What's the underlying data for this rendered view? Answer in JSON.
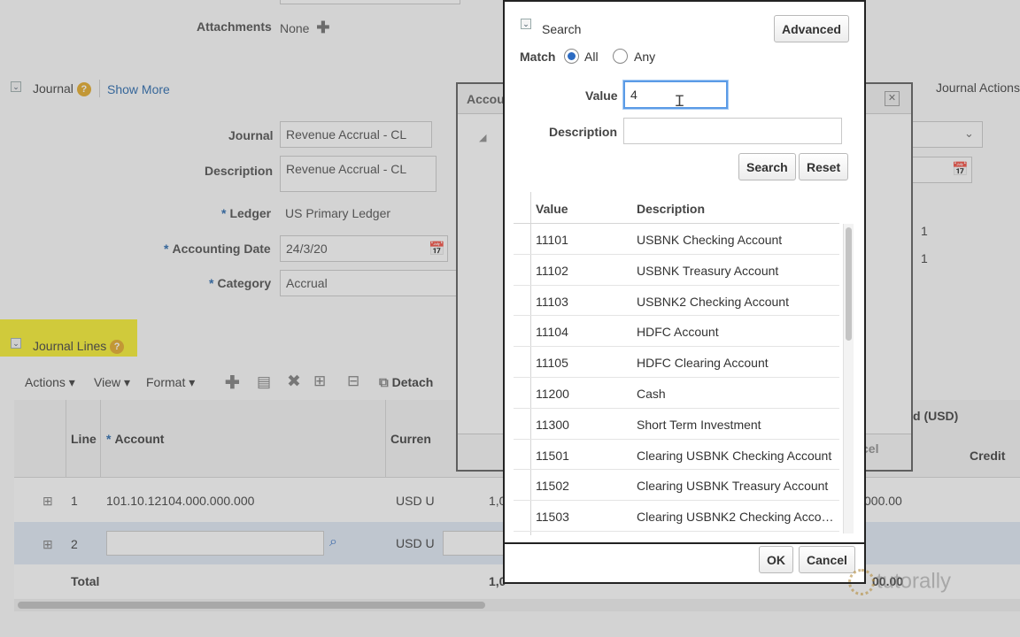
{
  "journal_page": {
    "attachments_label": "Attachments",
    "attachments_value": "None",
    "journal_section_label": "Journal",
    "show_more": "Show More",
    "journal_label": "Journal",
    "journal_value": "Revenue Accrual - CL",
    "description_label": "Description",
    "description_value": "Revenue Accrual - CL",
    "ledger_label": "Ledger",
    "ledger_value": "US Primary Ledger",
    "accounting_date_label": "Accounting Date",
    "accounting_date_value": "24/3/20",
    "category_label": "Category",
    "category_value": "Accrual",
    "journal_actions": "Journal Actions",
    "right_values": [
      "1",
      "1"
    ]
  },
  "journal_lines": {
    "section_label": "Journal Lines",
    "toolbar": {
      "actions": "Actions",
      "view": "View",
      "format": "Format",
      "detach": "Detach"
    },
    "columns": {
      "line": "Line",
      "account": "Account",
      "currency": "Curren",
      "debit_partial": "d (USD)",
      "credit": "Credit"
    },
    "rows": [
      {
        "line": "1",
        "account": "101.10.12104.000.000.000",
        "currency": "USD U",
        "amount_partial": "1,0",
        "right_amount": "000.00"
      },
      {
        "line": "2",
        "account": "",
        "currency": "USD U"
      }
    ],
    "total_label": "Total",
    "total_partial": "1,0",
    "total_right": "00.00"
  },
  "middle_dialog": {
    "title_partial": "Accou",
    "cancel_partial": "cel"
  },
  "search_popup": {
    "title": "Search",
    "advanced_button": "Advanced",
    "match_label": "Match",
    "match_all": "All",
    "match_any": "Any",
    "value_label": "Value",
    "value_input": "4",
    "description_label": "Description",
    "description_input": "",
    "search_button": "Search",
    "reset_button": "Reset",
    "table_headers": {
      "value": "Value",
      "description": "Description"
    },
    "results": [
      {
        "value": "11101",
        "description": "USBNK Checking Account"
      },
      {
        "value": "11102",
        "description": "USBNK Treasury Account"
      },
      {
        "value": "11103",
        "description": "USBNK2 Checking Account"
      },
      {
        "value": "11104",
        "description": "HDFC Account"
      },
      {
        "value": "11105",
        "description": "HDFC Clearing Account"
      },
      {
        "value": "11200",
        "description": "Cash"
      },
      {
        "value": "11300",
        "description": "Short Term Investment"
      },
      {
        "value": "11501",
        "description": "Clearing USBNK Checking Account"
      },
      {
        "value": "11502",
        "description": "Clearing USBNK Treasury Account"
      },
      {
        "value": "11503",
        "description": "Clearing USBNK2 Checking Acco…"
      }
    ],
    "ok_button": "OK",
    "cancel_button": "Cancel"
  },
  "watermark": "tutorally",
  "colors": {
    "accent_blue": "#2c6bc2",
    "link_blue": "#1a5fa8",
    "highlight_yellow": "#f7ee22",
    "help_orange": "#e3a51b"
  }
}
